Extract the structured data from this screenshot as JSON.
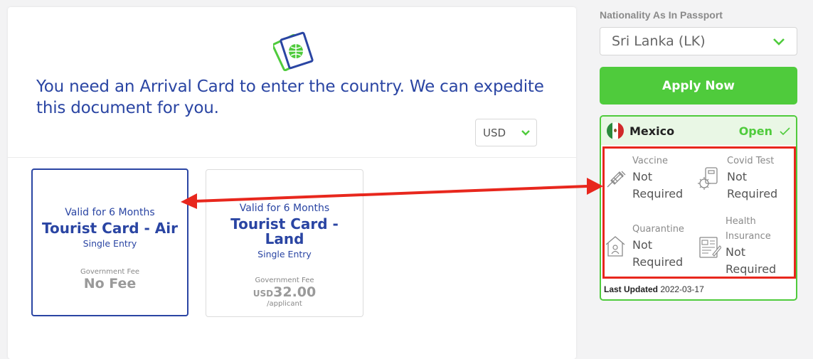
{
  "main": {
    "headline": "You need an Arrival Card to enter the country. We can expedite this document for you.",
    "currency": "USD",
    "cards": [
      {
        "valid": "Valid for 6 Months",
        "title": "Tourist Card - Air",
        "entry": "Single Entry",
        "fee_label": "Government Fee",
        "fee": "No Fee",
        "selected": true
      },
      {
        "valid": "Valid for 6 Months",
        "title": "Tourist Card - Land",
        "entry": "Single Entry",
        "fee_label": "Government Fee",
        "fee_currency": "USD",
        "fee": "32.00",
        "per": "/applicant",
        "selected": false
      }
    ]
  },
  "sidebar": {
    "nationality_label": "Nationality As In Passport",
    "nationality_value": "Sri Lanka (LK)",
    "apply_label": "Apply Now",
    "country": {
      "name": "Mexico",
      "status": "Open"
    },
    "requirements": [
      {
        "label": "Vaccine",
        "value": "Not Required",
        "icon": "syringe-icon"
      },
      {
        "label": "Covid Test",
        "value": "Not Required",
        "icon": "covid-test-icon"
      },
      {
        "label": "Quarantine",
        "value": "Not Required",
        "icon": "quarantine-house-icon"
      },
      {
        "label": "Health Insurance",
        "value": "Not Required",
        "icon": "insurance-document-icon"
      }
    ],
    "last_updated_label": "Last Updated",
    "last_updated_value": "2022-03-17"
  },
  "colors": {
    "primary_blue": "#2a45a3",
    "green": "#4fcb3c",
    "annotation_red": "#e8271d"
  }
}
